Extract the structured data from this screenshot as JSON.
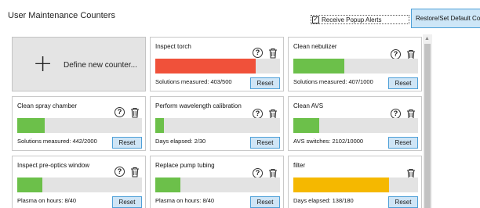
{
  "header": {
    "title": "User Maintenance Counters",
    "popup_checkbox_label": "Receive Popup Alerts",
    "popup_checked": true,
    "restore_button": "Restore/Set Default Counters"
  },
  "define_card": {
    "label": "Define new counter...",
    "plus": "+"
  },
  "colors": {
    "ok": "#6cc04a",
    "warning": "#f5b800",
    "alert": "#f0513a",
    "button_border": "#4ea0d8",
    "button_fill": "#cfe5f6"
  },
  "counters": [
    {
      "title": "Inspect torch",
      "status": "Solutions measured: 403/500",
      "reset": "Reset",
      "fraction": 0.806,
      "color": "#f0513a",
      "help": true
    },
    {
      "title": "Clean nebulizer",
      "status": "Solutions measured: 407/1000",
      "reset": "Reset",
      "fraction": 0.407,
      "color": "#6cc04a",
      "help": true
    },
    {
      "title": "Clean spray chamber",
      "status": "Solutions measured: 442/2000",
      "reset": "Reset",
      "fraction": 0.221,
      "color": "#6cc04a",
      "help": true
    },
    {
      "title": "Perform wavelength calibration",
      "status": "Days elapsed: 2/30",
      "reset": "Reset",
      "fraction": 0.067,
      "color": "#6cc04a",
      "help": true
    },
    {
      "title": "Clean AVS",
      "status": "AVS switches: 2102/10000",
      "reset": "Reset",
      "fraction": 0.21,
      "color": "#6cc04a",
      "help": true
    },
    {
      "title": "Inspect pre-optics window",
      "status": "Plasma on hours: 8/40",
      "reset": "Reset",
      "fraction": 0.2,
      "color": "#6cc04a",
      "help": true
    },
    {
      "title": "Replace pump tubing",
      "status": "Plasma on hours: 8/40",
      "reset": "Reset",
      "fraction": 0.2,
      "color": "#6cc04a",
      "help": true
    },
    {
      "title": "filter",
      "status": "Days elapsed: 138/180",
      "reset": "Reset",
      "fraction": 0.767,
      "color": "#f5b800",
      "help": false
    }
  ],
  "icons": {
    "help": "question-circle-icon",
    "delete": "trash-icon",
    "scroll_up": "chevron-up-icon"
  }
}
